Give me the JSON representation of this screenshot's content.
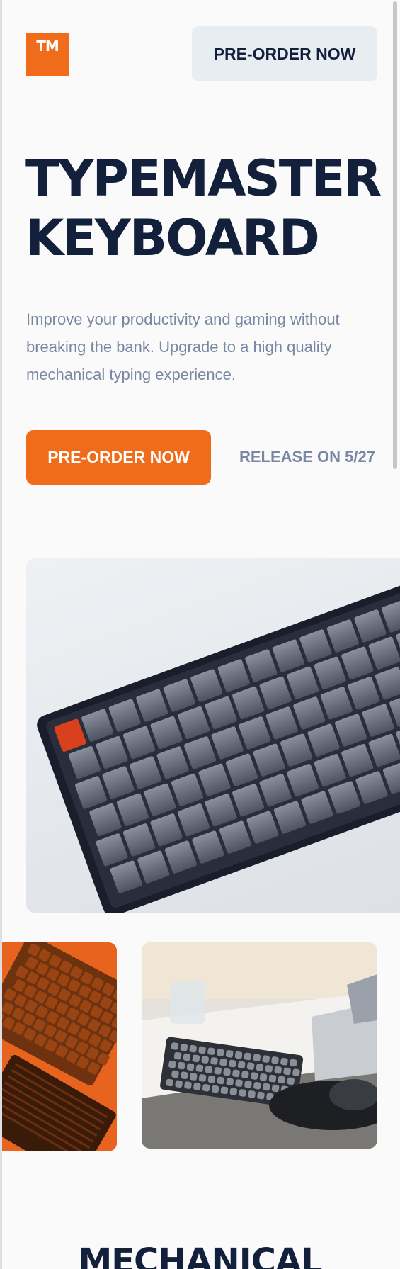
{
  "header": {
    "logo_text": "TM",
    "cta_label": "PRE-ORDER NOW"
  },
  "hero": {
    "title_line1": "TYPEMASTER",
    "title_line2": "KEYBOARD",
    "description": "Improve your productivity and gaming without breaking the bank. Upgrade to a high quality mechanical typing experience.",
    "cta_label": "PRE-ORDER NOW",
    "release_text": "RELEASE ON 5/27"
  },
  "gallery": {
    "hero_image": "keyboard-product-photo",
    "thumb1": "orange-keyboard-photo",
    "thumb2": "desk-keyboard-photo"
  },
  "features": {
    "title": "MECHANICAL"
  },
  "colors": {
    "accent": "#f06c1b",
    "navy": "#13203b",
    "muted": "#7a87a3",
    "light_button": "#e8edf2"
  }
}
